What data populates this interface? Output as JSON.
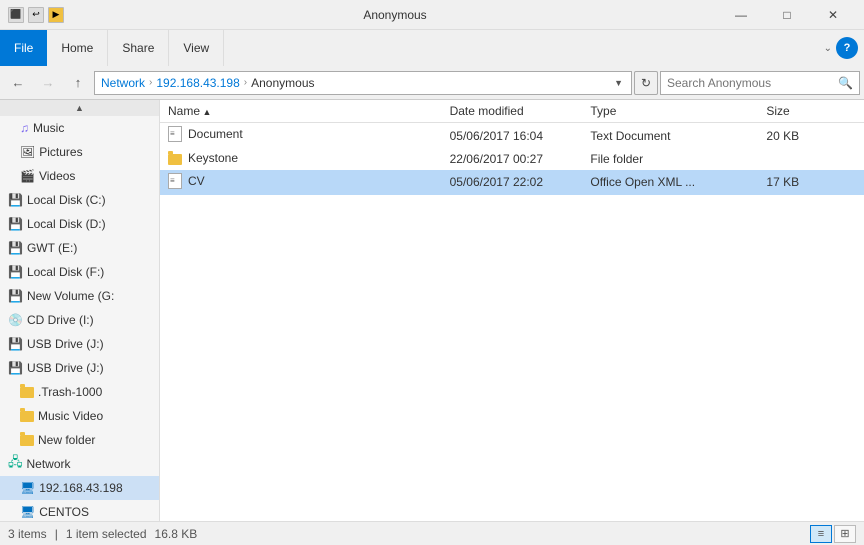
{
  "window": {
    "title": "Anonymous",
    "controls": {
      "minimize": "—",
      "maximize": "□",
      "close": "✕"
    }
  },
  "title_bar_icons": [
    {
      "label": "⬛",
      "type": "plain"
    },
    {
      "label": "↩",
      "type": "plain"
    },
    {
      "label": "▶",
      "type": "yellow"
    }
  ],
  "ribbon": {
    "file_label": "File",
    "tabs": [
      "Home",
      "Share",
      "View"
    ]
  },
  "nav": {
    "back_label": "←",
    "forward_label": "→",
    "up_label": "↑",
    "breadcrumb": [
      "Network",
      "192.168.43.198",
      "Anonymous"
    ],
    "refresh_label": "↺",
    "search_placeholder": "Search Anonymous"
  },
  "sidebar": {
    "scroll_up": "▲",
    "scroll_down": "▼",
    "items": [
      {
        "label": "Music",
        "icon": "music",
        "indent": 1
      },
      {
        "label": "Pictures",
        "icon": "pictures",
        "indent": 1
      },
      {
        "label": "Videos",
        "icon": "videos",
        "indent": 1
      },
      {
        "label": "Local Disk (C:)",
        "icon": "drive",
        "indent": 0
      },
      {
        "label": "Local Disk (D:)",
        "icon": "drive",
        "indent": 0
      },
      {
        "label": "GWT (E:)",
        "icon": "drive",
        "indent": 0
      },
      {
        "label": "Local Disk (F:)",
        "icon": "drive",
        "indent": 0
      },
      {
        "label": "New Volume (G:",
        "icon": "drive",
        "indent": 0
      },
      {
        "label": "CD Drive (I:)",
        "icon": "cd",
        "indent": 0
      },
      {
        "label": "USB Drive (J:)",
        "icon": "usb",
        "indent": 0
      },
      {
        "label": "USB Drive (J:)",
        "icon": "usb",
        "indent": 0
      },
      {
        "label": ".Trash-1000",
        "icon": "folder",
        "indent": 1
      },
      {
        "label": "Music Video",
        "icon": "folder",
        "indent": 1
      },
      {
        "label": "New folder",
        "icon": "folder",
        "indent": 1
      },
      {
        "label": "Network",
        "icon": "network",
        "indent": 0
      },
      {
        "label": "192.168.43.198",
        "icon": "computer",
        "indent": 1,
        "selected": true
      },
      {
        "label": "CENTOS",
        "icon": "computer",
        "indent": 1
      }
    ]
  },
  "file_list": {
    "columns": [
      {
        "key": "name",
        "label": "Name",
        "width": "40%"
      },
      {
        "key": "date",
        "label": "Date modified",
        "width": "20%"
      },
      {
        "key": "type",
        "label": "Type",
        "width": "25%"
      },
      {
        "key": "size",
        "label": "Size",
        "width": "15%"
      }
    ],
    "rows": [
      {
        "name": "Document",
        "date": "05/06/2017 16:04",
        "type": "Text Document",
        "size": "20 KB",
        "icon": "doc",
        "selected": false
      },
      {
        "name": "Keystone",
        "date": "22/06/2017 00:27",
        "type": "File folder",
        "size": "",
        "icon": "folder",
        "selected": false
      },
      {
        "name": "CV",
        "date": "05/06/2017 22:02",
        "type": "Office Open XML ...",
        "size": "17 KB",
        "icon": "xml",
        "selected": true
      }
    ]
  },
  "status_bar": {
    "count": "3 items",
    "selected": "1 item selected",
    "size": "16.8 KB"
  },
  "colors": {
    "accent": "#0078d7",
    "selected_bg": "#b8d8f8",
    "selected_row": "#cce8ff",
    "sidebar_selected": "#cce0f5"
  }
}
